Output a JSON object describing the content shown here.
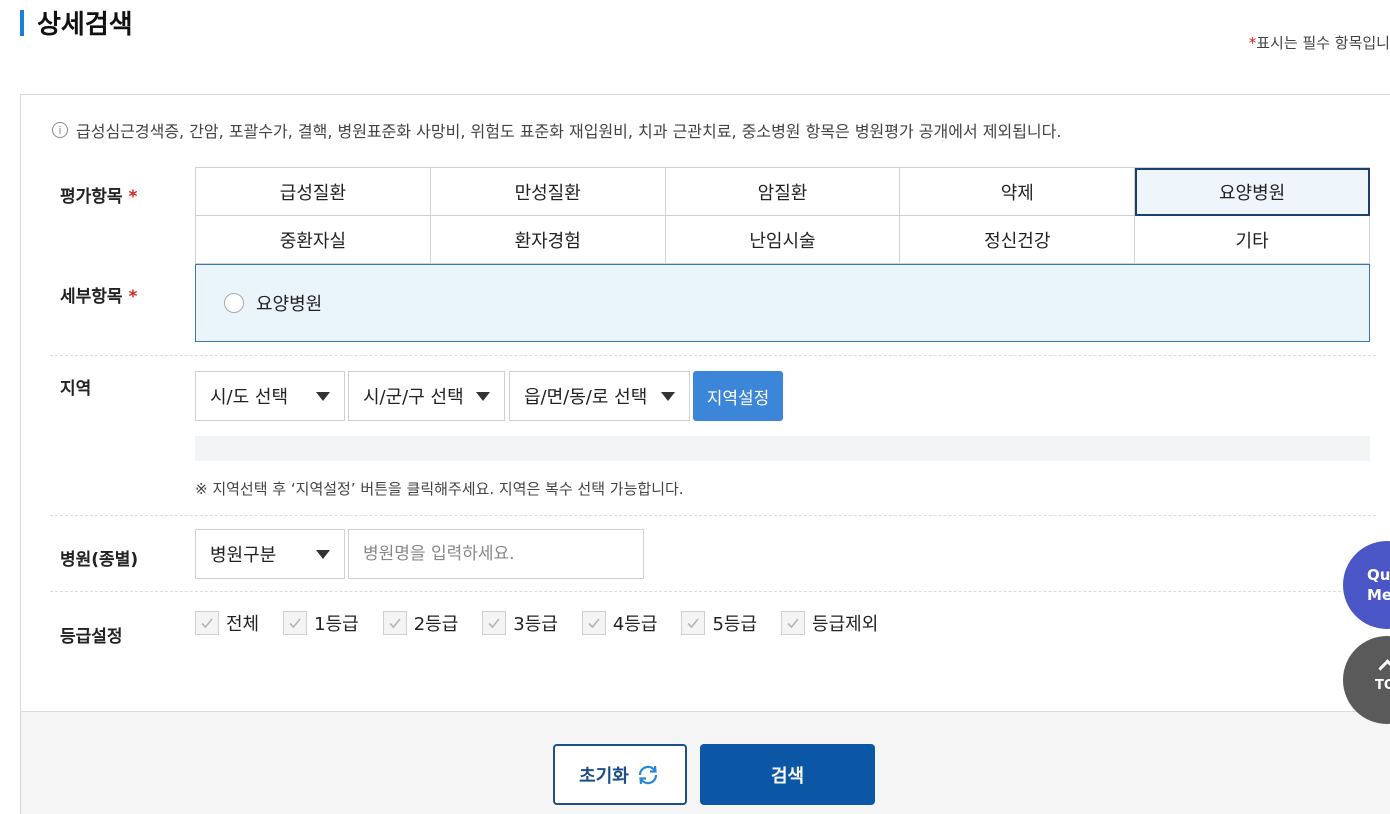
{
  "page": {
    "title": "상세검색",
    "required_mark": "*",
    "required_note": "표시는 필수 항목입니"
  },
  "info": {
    "icon": "info-circle-icon",
    "icon_glyph": "i",
    "text": "급성심근경색증, 간암, 포괄수가, 결핵, 병원표준화 사망비, 위험도 표준화 재입원비, 치과 근관치료, 중소병원 항목은 병원평가 공개에서 제외됩니다."
  },
  "evaluation": {
    "label": "평가항목",
    "star": "*",
    "selected": "요양병원",
    "items": [
      "급성질환",
      "만성질환",
      "암질환",
      "약제",
      "요양병원",
      "중환자실",
      "환자경험",
      "난임시술",
      "정신건강",
      "기타"
    ]
  },
  "detail": {
    "label": "세부항목",
    "star": "*",
    "options": [
      "요양병원"
    ]
  },
  "region": {
    "label": "지역",
    "sido": "시/도 선택",
    "sigungu": "시/군/구 선택",
    "dong": "읍/면/동/로 선택",
    "set_button": "지역설정",
    "help": "※ 지역선택 후 ‘지역설정’ 버튼을 클릭해주세요. 지역은 복수 선택 가능합니다."
  },
  "hospital": {
    "label": "병원(종별)",
    "type_select": "병원구분",
    "name_placeholder": "병원명을 입력하세요.",
    "name_value": ""
  },
  "grade": {
    "label": "등급설정",
    "options": [
      "전체",
      "1등급",
      "2등급",
      "3등급",
      "4등급",
      "5등급",
      "등급제외"
    ]
  },
  "actions": {
    "reset": "초기화",
    "search": "검색"
  },
  "floating": {
    "quick_menu_line1": "Qui",
    "quick_menu_line2": "Me",
    "top": "TO"
  },
  "colors": {
    "accent": "#1a7fd8",
    "required": "#d9231d",
    "region_button": "#3b86d8",
    "search_button": "#0b57a5",
    "quick_menu": "#4a55c6"
  }
}
